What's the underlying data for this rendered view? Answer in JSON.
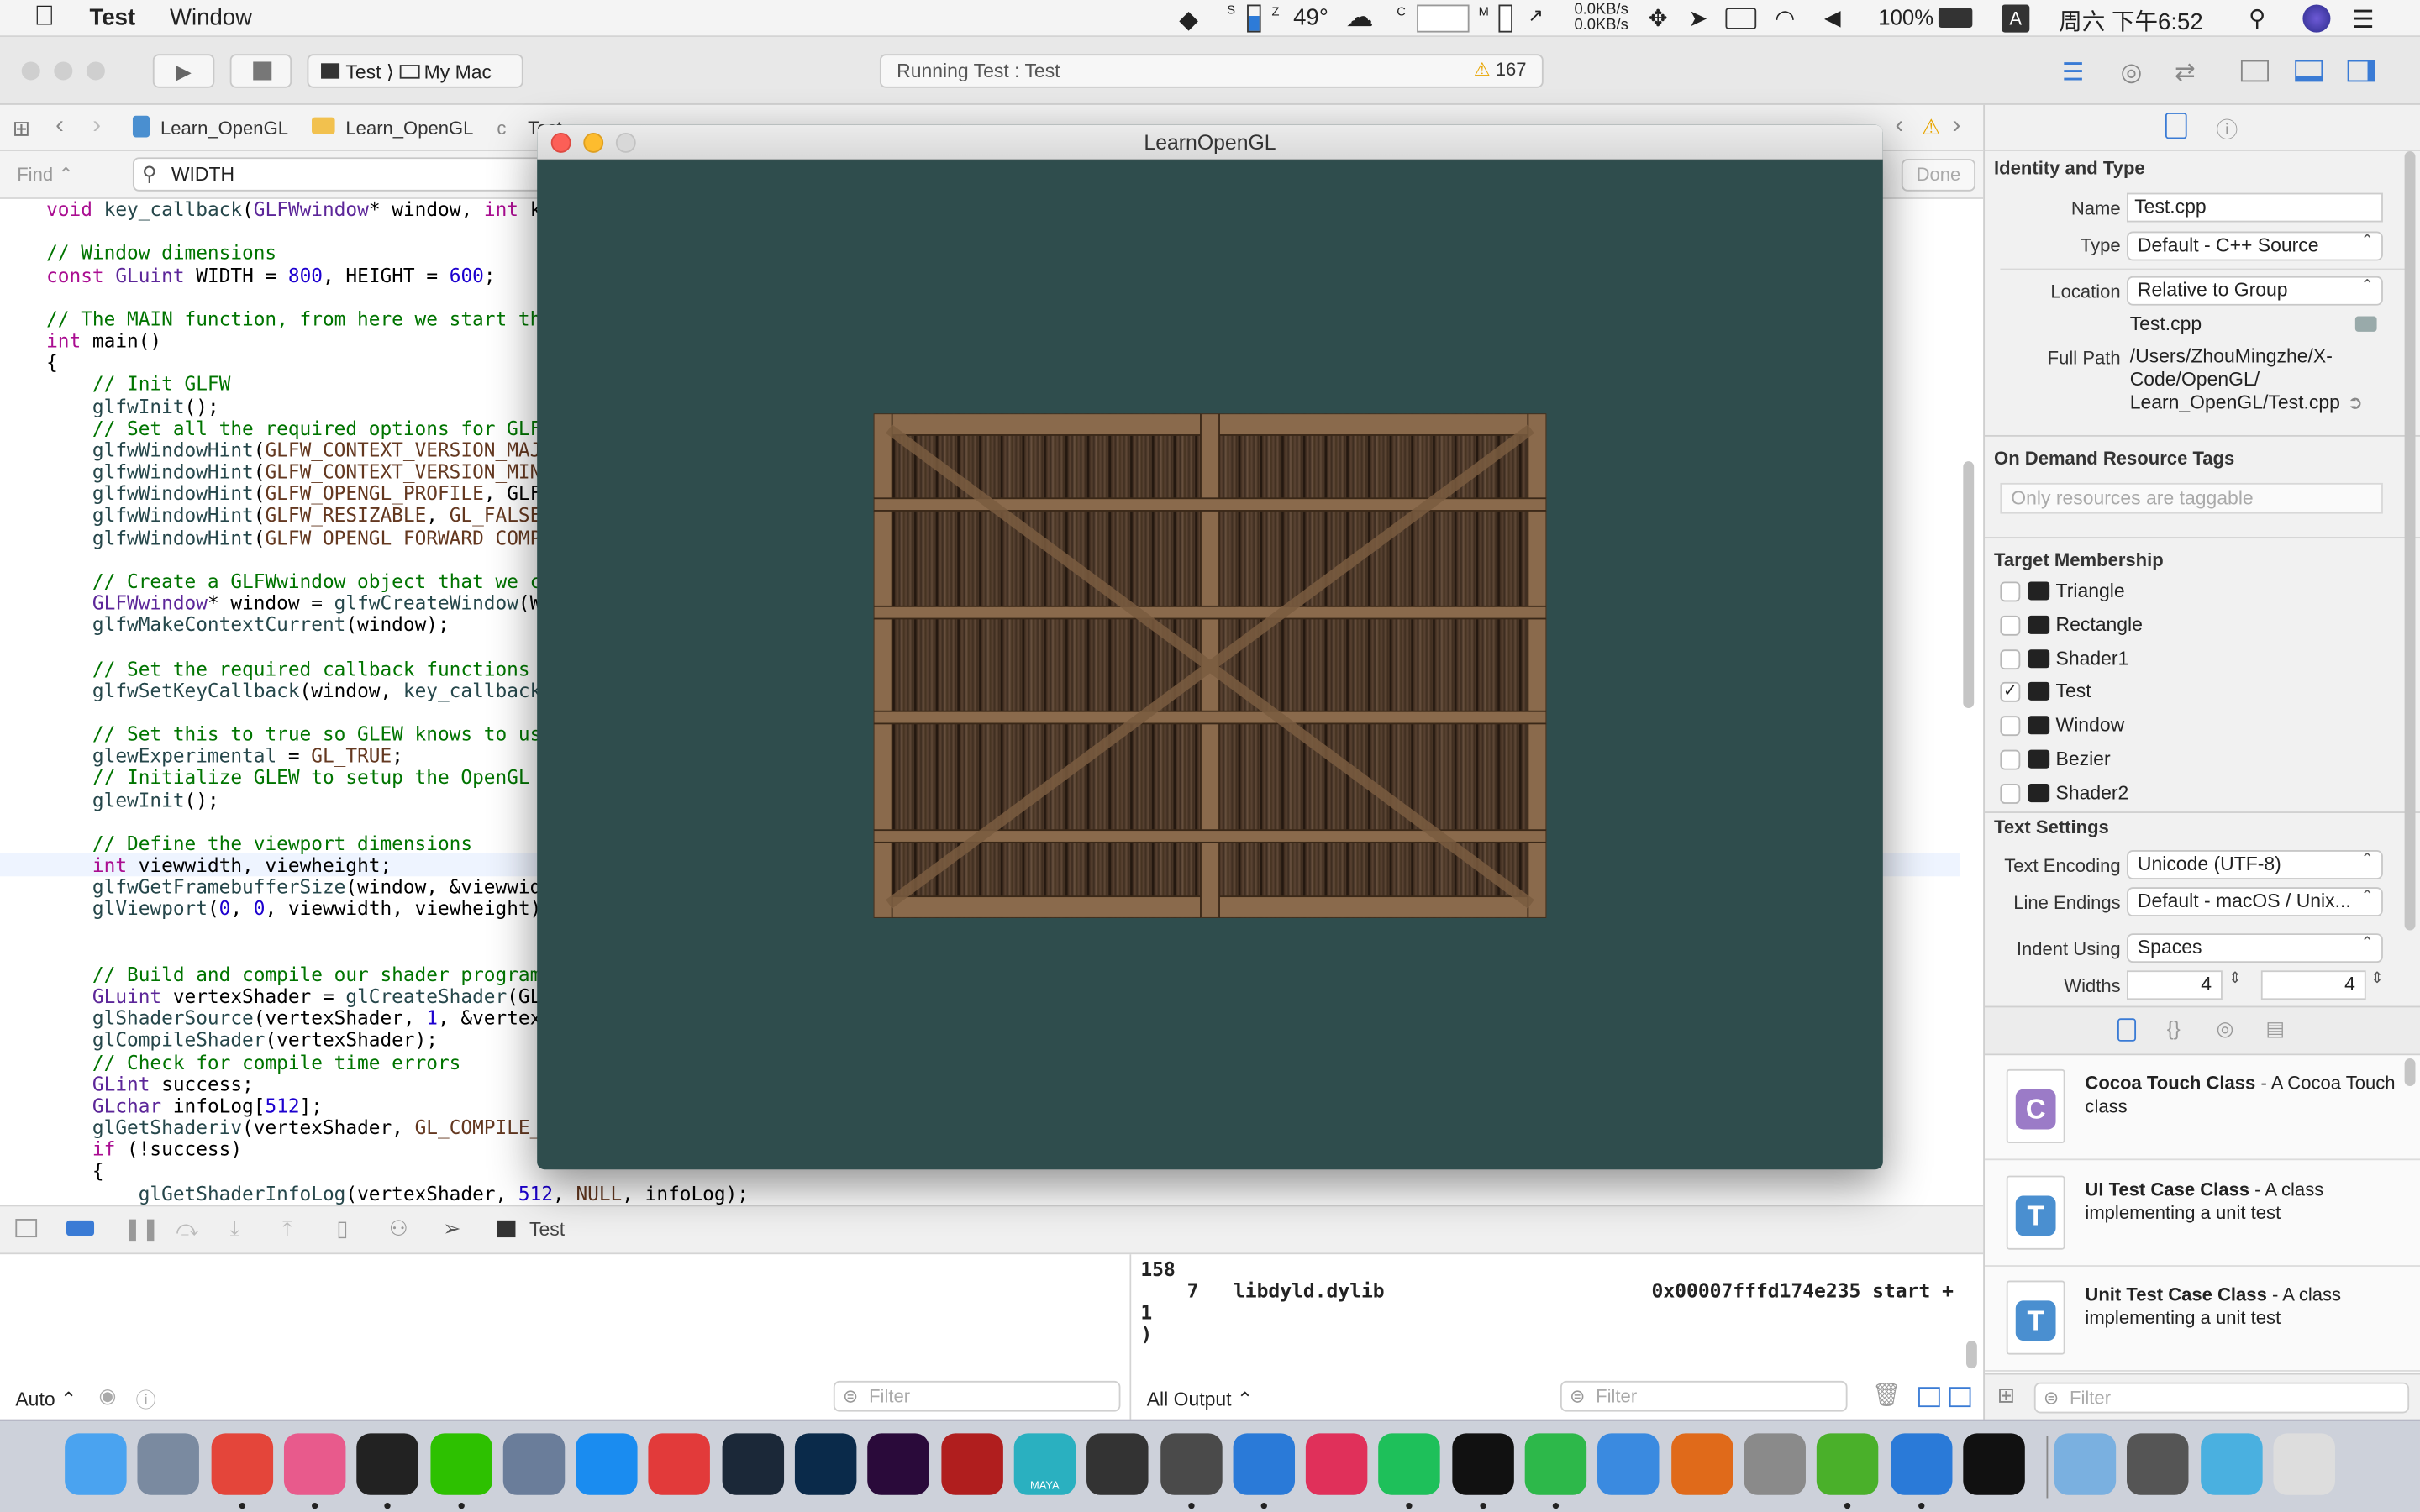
{
  "menubar": {
    "app_name": "Test",
    "menu_window": "Window",
    "temp": "49°",
    "net_up": "0.0KB/s",
    "net_down": "0.0KB/s",
    "battery": "100%",
    "input_method": "A",
    "clock": "周六 下午6:52",
    "sensor_s": "S",
    "sensor_c": "C",
    "sensor_m": "M"
  },
  "toolbar": {
    "scheme_target": "Test",
    "scheme_device": "My Mac",
    "status_text": "Running Test : Test",
    "warning_count": "167"
  },
  "jumpbar": {
    "crumbs": [
      "Learn_OpenGL",
      "Learn_OpenGL",
      "Test"
    ]
  },
  "findbar": {
    "mode": "Find",
    "query": "WIDTH",
    "done_label": "Done"
  },
  "editor": {
    "lines": [
      "void key_callback(GLFWwindow* window, int k",
      "",
      "// Window dimensions",
      "const GLuint WIDTH = 800, HEIGHT = 600;",
      "",
      "// The MAIN function, from here we start th",
      "int main()",
      "{",
      "    // Init GLFW",
      "    glfwInit();",
      "    // Set all the required options for GLF",
      "    glfwWindowHint(GLFW_CONTEXT_VERSION_MAJ",
      "    glfwWindowHint(GLFW_CONTEXT_VERSION_MIN",
      "    glfwWindowHint(GLFW_OPENGL_PROFILE, GLF",
      "    glfwWindowHint(GLFW_RESIZABLE, GL_FALSE",
      "    glfwWindowHint(GLFW_OPENGL_FORWARD_COMP",
      "",
      "    // Create a GLFWwindow object that we c",
      "    GLFWwindow* window = glfwCreateWindow(W",
      "    glfwMakeContextCurrent(window);",
      "",
      "    // Set the required callback functions",
      "    glfwSetKeyCallback(window, key_callback",
      "",
      "    // Set this to true so GLEW knows to us",
      "    glewExperimental = GL_TRUE;",
      "    // Initialize GLEW to setup the OpenGL",
      "    glewInit();",
      "",
      "    // Define the viewport dimensions",
      "    int viewwidth, viewheight;",
      "    glfwGetFramebufferSize(window, &viewwid",
      "    glViewport(0, 0, viewwidth, viewheight)",
      "",
      "",
      "    // Build and compile our shader program",
      "    GLuint vertexShader = glCreateShader(GL",
      "    glShaderSource(vertexShader, 1, &vertex",
      "    glCompileShader(vertexShader);",
      "    // Check for compile time errors",
      "    GLint success;",
      "    GLchar infoLog[512];",
      "    glGetShaderiv(vertexShader, GL_COMPILE_",
      "    if (!success)",
      "    {",
      "        glGetShaderInfoLog(vertexShader, 512, NULL, infoLog);"
    ]
  },
  "debug": {
    "target": "Test",
    "auto_label": "Auto",
    "filter_placeholder": "Filter",
    "output_label": "All Output"
  },
  "console": {
    "lines": [
      "158",
      "    7   libdyld.dylib                       0x00007fffd174e235 start +",
      "1",
      ")"
    ]
  },
  "glwindow": {
    "title": "LearnOpenGL",
    "clear_color": "#2f4d4d"
  },
  "inspector": {
    "identity_title": "Identity and Type",
    "name_label": "Name",
    "name_value": "Test.cpp",
    "type_label": "Type",
    "type_value": "Default - C++ Source",
    "location_label": "Location",
    "location_value": "Relative to Group",
    "file_name": "Test.cpp",
    "fullpath_label": "Full Path",
    "fullpath_lines": [
      "/Users/ZhouMingzhe/X-",
      "Code/OpenGL/",
      "Learn_OpenGL/Test.cpp"
    ],
    "ondemand_title": "On Demand Resource Tags",
    "ondemand_placeholder": "Only resources are taggable",
    "target_title": "Target Membership",
    "targets": [
      {
        "name": "Triangle",
        "checked": false
      },
      {
        "name": "Rectangle",
        "checked": false
      },
      {
        "name": "Shader1",
        "checked": false
      },
      {
        "name": "Test",
        "checked": true
      },
      {
        "name": "Window",
        "checked": false
      },
      {
        "name": "Bezier",
        "checked": false
      },
      {
        "name": "Shader2",
        "checked": false
      }
    ],
    "text_title": "Text Settings",
    "encoding_label": "Text Encoding",
    "encoding_value": "Unicode (UTF-8)",
    "endings_label": "Line Endings",
    "endings_value": "Default - macOS / Unix...",
    "indent_label": "Indent Using",
    "indent_value": "Spaces",
    "widths_label": "Widths",
    "width_tab": "4",
    "width_indent": "4",
    "check_mark": "✓"
  },
  "library": {
    "items": [
      {
        "letter": "C",
        "title": "Cocoa Touch Class",
        "desc": " - A Cocoa Touch class",
        "color": "#9b7bc7"
      },
      {
        "letter": "T",
        "title": "UI Test Case Class",
        "desc": " - A class implementing a unit test",
        "color": "#4a8fd0"
      },
      {
        "letter": "T",
        "title": "Unit Test Case Class",
        "desc": " - A class implementing a unit test",
        "color": "#4a8fd0"
      }
    ],
    "filter_placeholder": "Filter"
  },
  "dock": {
    "apps": [
      "Finder",
      "Launchpad",
      "Chrome",
      "Paper Plane",
      "QQ",
      "WeChat",
      "Preview",
      "App Store",
      "NetEase Music",
      "Steam",
      "Photoshop",
      "Premiere",
      "Acrobat",
      "Maya",
      "Unity",
      "Sublime Text",
      "Xcode",
      "Video Player",
      "iQIYI",
      "Terminal",
      "Evernote",
      "Lark",
      "Paw",
      "System Preferences",
      "uTorrent",
      "MWeb",
      "Exec",
      "Downloads",
      "Photos",
      "Weather",
      "Trash"
    ],
    "maya_label": "MAYA"
  }
}
